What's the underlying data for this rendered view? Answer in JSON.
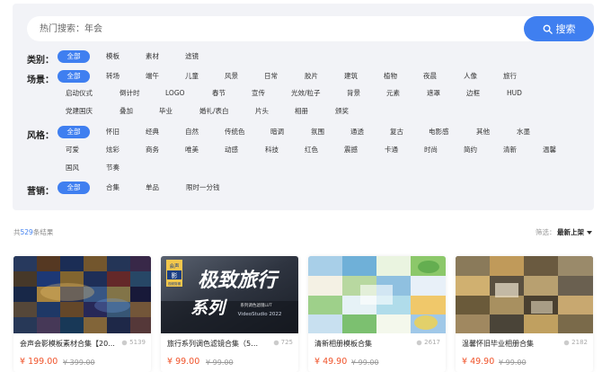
{
  "search": {
    "placeholder": "热门搜索：年会",
    "button_label": "搜索"
  },
  "filters": {
    "category": {
      "label": "类别：",
      "options": [
        "全部",
        "模板",
        "素材",
        "滤镜"
      ]
    },
    "scene": {
      "label": "场景：",
      "options": [
        "全部",
        "转场",
        "端午",
        "儿童",
        "风景",
        "日常",
        "胶片",
        "建筑",
        "植物",
        "夜晨",
        "人像",
        "旅行",
        "启动仪式",
        "倒计时",
        "LOGO",
        "春节",
        "宣传",
        "光效/粒子",
        "背景",
        "元素",
        "遮罩",
        "边框",
        "HUD",
        "党建国庆",
        "叠加",
        "毕业",
        "婚礼/表白",
        "片头",
        "相册",
        "颁奖"
      ]
    },
    "style": {
      "label": "风格：",
      "options": [
        "全部",
        "怀旧",
        "经典",
        "自然",
        "传统色",
        "暗调",
        "氛围",
        "通透",
        "复古",
        "电影感",
        "其他",
        "水墨",
        "可爱",
        "炫彩",
        "商务",
        "唯美",
        "动感",
        "科技",
        "红色",
        "震撼",
        "卡通",
        "时尚",
        "简约",
        "清新",
        "温馨",
        "国风",
        "节奏"
      ]
    },
    "marketing": {
      "label": "营销：",
      "options": [
        "全部",
        "合集",
        "单品",
        "限时一分钱"
      ]
    }
  },
  "results": {
    "prefix": "共",
    "count": "529",
    "suffix": "条结果",
    "sort_label": "筛选：",
    "sort_value": "最新上架"
  },
  "products": [
    {
      "title": "会声会影模板素材合集【20...",
      "views": "5139",
      "price": "¥ 199.00",
      "original_price": "¥ 399.00"
    },
    {
      "title": "旅行系列调色滤镜合集（5款...",
      "views": "725",
      "price": "¥ 99.00",
      "original_price": "¥ 99.00",
      "thumb_text": {
        "main": "极致旅行",
        "sub": "系列",
        "brand_top": "会声",
        "brand_mid": "影",
        "brand_bottom": "视频剪辑",
        "tag": "系列调色滤镜LUT",
        "tag2": "VideoStudio 2022"
      }
    },
    {
      "title": "清新相册模板合集",
      "views": "2617",
      "price": "¥ 49.90",
      "original_price": "¥ 99.00"
    },
    {
      "title": "温馨怀旧毕业相册合集",
      "views": "2182",
      "price": "¥ 49.90",
      "original_price": "¥ 99.00"
    }
  ],
  "colors": {
    "accent": "#3f7ff0",
    "price": "#f0532a",
    "panel_bg": "#f2f3f7"
  }
}
